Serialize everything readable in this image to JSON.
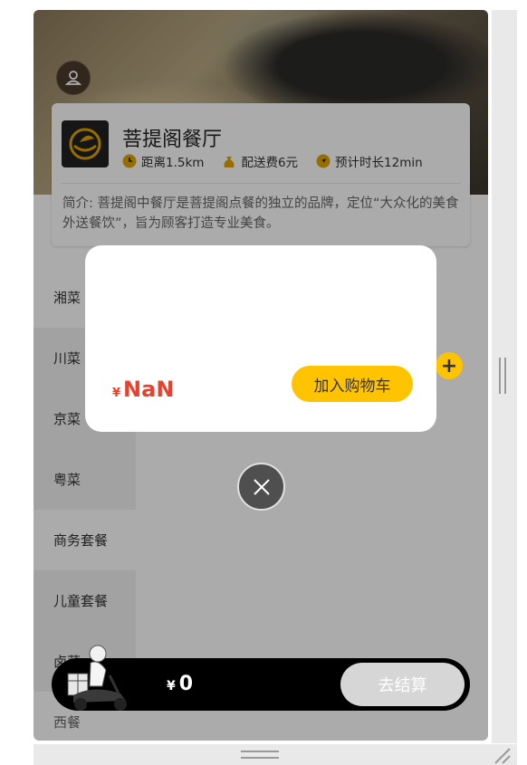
{
  "shop": {
    "name": "菩提阁餐厅",
    "distance": "距离1.5km",
    "delivery_fee": "配送费6元",
    "eta": "预计时长12min",
    "intro": "简介: 菩提阁中餐厅是菩提阁点餐的独立的品牌，定位“大众化的美食外送餐饮”，旨为顾客打造专业美食。"
  },
  "categories": [
    "湘菜",
    "川菜",
    "京菜",
    "粤菜",
    "商务套餐",
    "儿童套餐",
    "卤菜"
  ],
  "bottom_category": "西餐",
  "cart": {
    "currency": "¥",
    "total": "0",
    "checkout_label": "去结算"
  },
  "modal": {
    "currency": "¥",
    "price": "NaN",
    "add_label": "加入购物车"
  },
  "add_icon": "+",
  "colors": {
    "accent": "#ffc300",
    "price": "#e8412d",
    "cartbar": "#000000"
  }
}
